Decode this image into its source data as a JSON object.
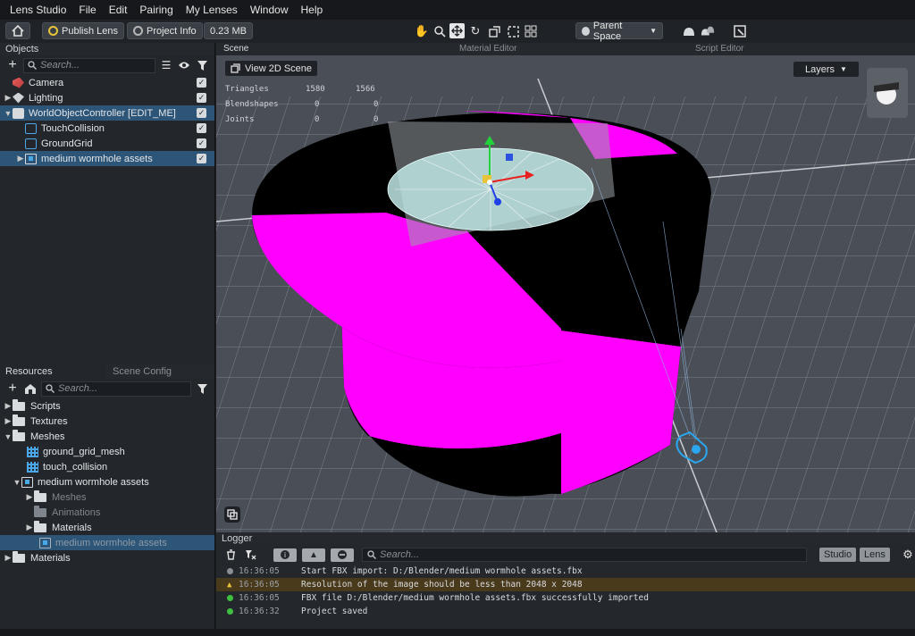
{
  "menu": [
    "Lens Studio",
    "File",
    "Edit",
    "Pairing",
    "My Lenses",
    "Window",
    "Help"
  ],
  "toolbar": {
    "publish_label": "Publish Lens",
    "project_info_label": "Project Info",
    "size_label": "0.23 MB",
    "space_label": "Parent Space"
  },
  "objects": {
    "title": "Objects",
    "search_placeholder": "Search...",
    "items": [
      {
        "label": "Camera"
      },
      {
        "label": "Lighting"
      },
      {
        "label": "WorldObjectController [EDIT_ME]"
      },
      {
        "label": "TouchCollision"
      },
      {
        "label": "GroundGrid"
      },
      {
        "label": "medium wormhole assets"
      }
    ]
  },
  "resources": {
    "tabs": [
      "Resources",
      "Scene Config"
    ],
    "search_placeholder": "Search...",
    "items": [
      {
        "label": "Scripts"
      },
      {
        "label": "Textures"
      },
      {
        "label": "Meshes"
      },
      {
        "label": "ground_grid_mesh"
      },
      {
        "label": "touch_collision"
      },
      {
        "label": "medium wormhole assets"
      },
      {
        "label": "Meshes"
      },
      {
        "label": "Animations"
      },
      {
        "label": "Materials"
      },
      {
        "label": "medium wormhole assets"
      },
      {
        "label": "Materials"
      }
    ]
  },
  "scene": {
    "tabs": [
      "Scene",
      "Material Editor",
      "Script Editor"
    ],
    "view2d_label": "View 2D Scene",
    "layers_label": "Layers",
    "stats": [
      {
        "name": "Triangles",
        "a": "1580",
        "b": "1566"
      },
      {
        "name": "Blendshapes",
        "a": "0",
        "b": "0"
      },
      {
        "name": "Joints",
        "a": "0",
        "b": "0"
      }
    ]
  },
  "logger": {
    "title": "Logger",
    "search_placeholder": "Search...",
    "studio_label": "Studio",
    "lens_label": "Lens",
    "lines": [
      {
        "time": "16:36:05",
        "text": "Start FBX import: D:/Blender/medium wormhole assets.fbx",
        "level": "info"
      },
      {
        "time": "16:36:05",
        "text": "Resolution of the image should be less than 2048 x 2048",
        "level": "warn"
      },
      {
        "time": "16:36:05",
        "text": "FBX file D:/Blender/medium wormhole assets.fbx successfully imported",
        "level": "ok"
      },
      {
        "time": "16:36:32",
        "text": "Project saved",
        "level": "ok"
      }
    ]
  },
  "colors": {
    "accent": "#2d5578",
    "magenta": "#ff00ff",
    "ok": "#3fbf3f",
    "info": "#8a9096",
    "warn": "#e8c43a"
  }
}
